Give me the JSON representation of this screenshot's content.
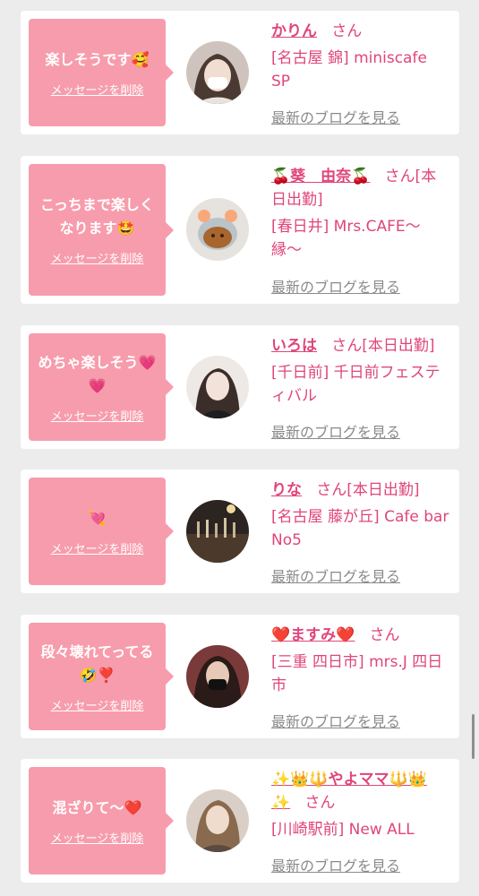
{
  "common": {
    "delete_label": "メッセージを削除",
    "blog_label": "最新のブログを見る"
  },
  "cards": [
    {
      "message": "楽しそうです🥰",
      "name": "かりん",
      "honorific": "さん",
      "shop": "[名古屋 錦] miniscafe SP"
    },
    {
      "message": "こっちまで楽しくなります🤩",
      "name": "🍒葵　由奈🍒",
      "honorific": "さん[本日出勤]",
      "shop": "[春日井] Mrs.CAFE〜縁〜"
    },
    {
      "message": "めちゃ楽しそう💗💗",
      "name": "いろは",
      "honorific": "さん[本日出勤]",
      "shop": "[千日前] 千日前フェスティバル"
    },
    {
      "message": "💘",
      "name": "りな",
      "honorific": "さん[本日出勤]",
      "shop": "[名古屋 藤が丘] Cafe bar No5"
    },
    {
      "message": "段々壊れてってる🤣❣️",
      "name": "❤️ますみ❤️",
      "honorific": "さん",
      "shop": "[三重 四日市] mrs.J 四日市"
    },
    {
      "message": "混ざりて〜❤️",
      "name": "✨👑🔱やよママ🔱👑✨",
      "honorific": "さん",
      "shop": "[川崎駅前] New ALL"
    }
  ]
}
